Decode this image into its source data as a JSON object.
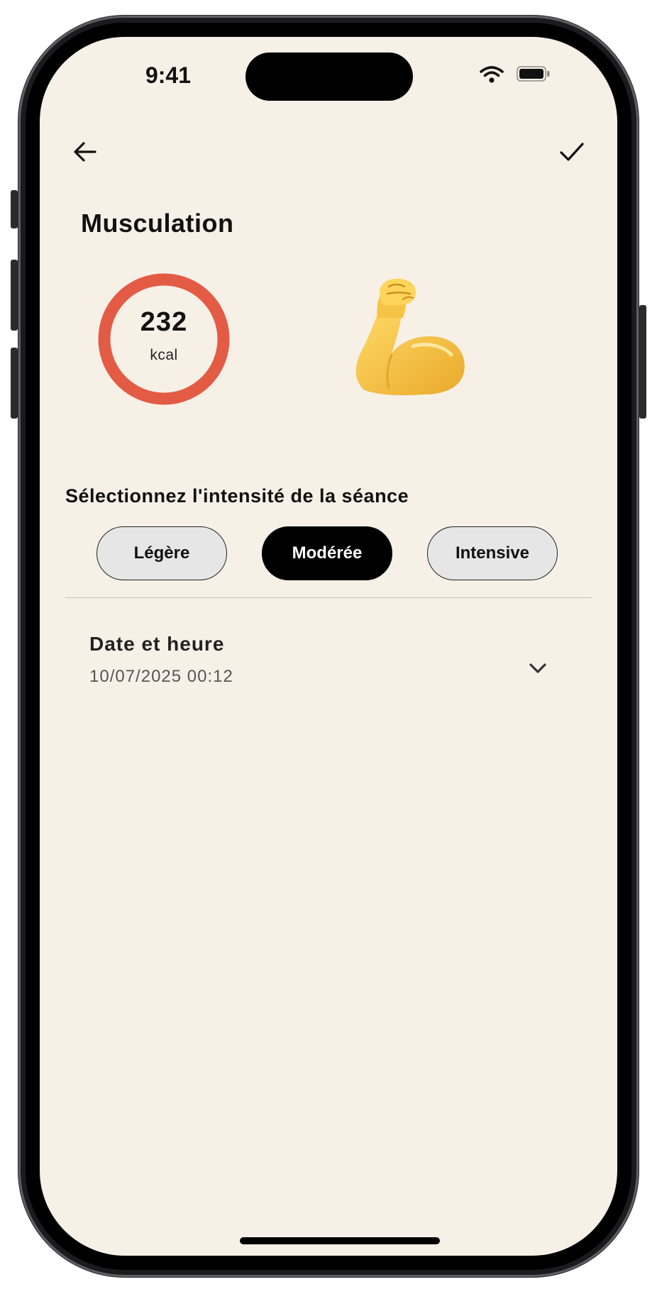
{
  "status_bar": {
    "time": "9:41"
  },
  "header": {
    "back_icon": "arrow-left-icon",
    "confirm_icon": "checkmark-icon",
    "title": "Musculation"
  },
  "summary": {
    "calories_value": "232",
    "calories_unit": "kcal",
    "ring_color": "#e35b45",
    "activity_icon": "flexed-biceps-icon",
    "emoji_color": "#f4c542"
  },
  "intensity": {
    "heading": "Sélectionnez l'intensité de la séance",
    "options": [
      {
        "label": "Légère",
        "selected": false
      },
      {
        "label": "Modérée",
        "selected": true
      },
      {
        "label": "Intensive",
        "selected": false
      }
    ]
  },
  "datetime": {
    "label": "Date et heure",
    "value": "10/07/2025 00:12",
    "expand_icon": "chevron-down-icon"
  },
  "colors": {
    "background": "#f7f0e7",
    "accent_selected": "#000000",
    "pill_default": "#e6e6e6"
  }
}
